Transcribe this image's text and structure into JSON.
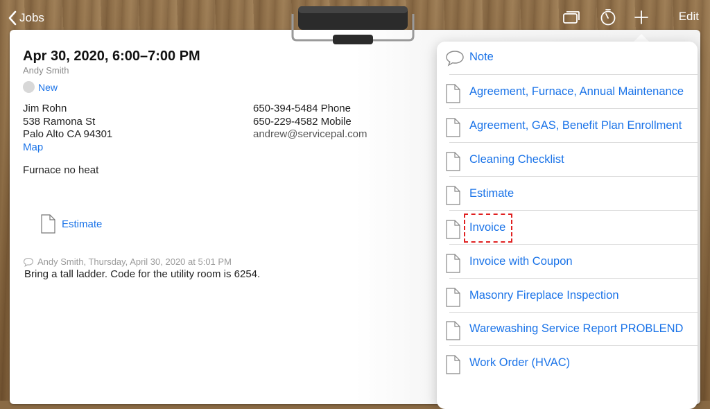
{
  "topbar": {
    "back_label": "Jobs",
    "edit_label": "Edit",
    "icons": [
      "back-chevron-icon",
      "cards-icon",
      "timer-icon",
      "plus-icon"
    ]
  },
  "job": {
    "title": "Apr 30, 2020, 6:00–7:00 PM",
    "technician": "Andy Smith",
    "status": "New",
    "customer_name": "Jim Rohn",
    "address_line1": "538 Ramona St",
    "address_line2": "Palo Alto CA 94301",
    "map_label": "Map",
    "phone": "650-394-5484 Phone",
    "mobile": "650-229-4582 Mobile",
    "email": "andrew@servicepal.com",
    "description": "Furnace no heat",
    "attachment_label": "Estimate",
    "note_meta": "Andy Smith, Thursday, April 30, 2020 at 5:01 PM",
    "note_text": "Bring a tall ladder. Code for the utility room is 6254."
  },
  "popover": {
    "items": [
      {
        "label": "Note",
        "icon": "speech-bubble-icon"
      },
      {
        "label": "Agreement, Furnace, Annual Maintenance",
        "icon": "document-icon"
      },
      {
        "label": "Agreement, GAS, Benefit Plan Enrollment",
        "icon": "document-icon"
      },
      {
        "label": "Cleaning Checklist",
        "icon": "document-icon"
      },
      {
        "label": "Estimate",
        "icon": "document-icon"
      },
      {
        "label": "Invoice",
        "icon": "document-icon"
      },
      {
        "label": "Invoice with Coupon",
        "icon": "document-icon"
      },
      {
        "label": "Masonry Fireplace Inspection",
        "icon": "document-icon"
      },
      {
        "label": "Warewashing Service Report PROBLEND",
        "icon": "document-icon"
      },
      {
        "label": "Work Order (HVAC)",
        "icon": "document-icon"
      }
    ]
  },
  "colors": {
    "accent": "#1a73e8",
    "highlight": "#e02020"
  }
}
